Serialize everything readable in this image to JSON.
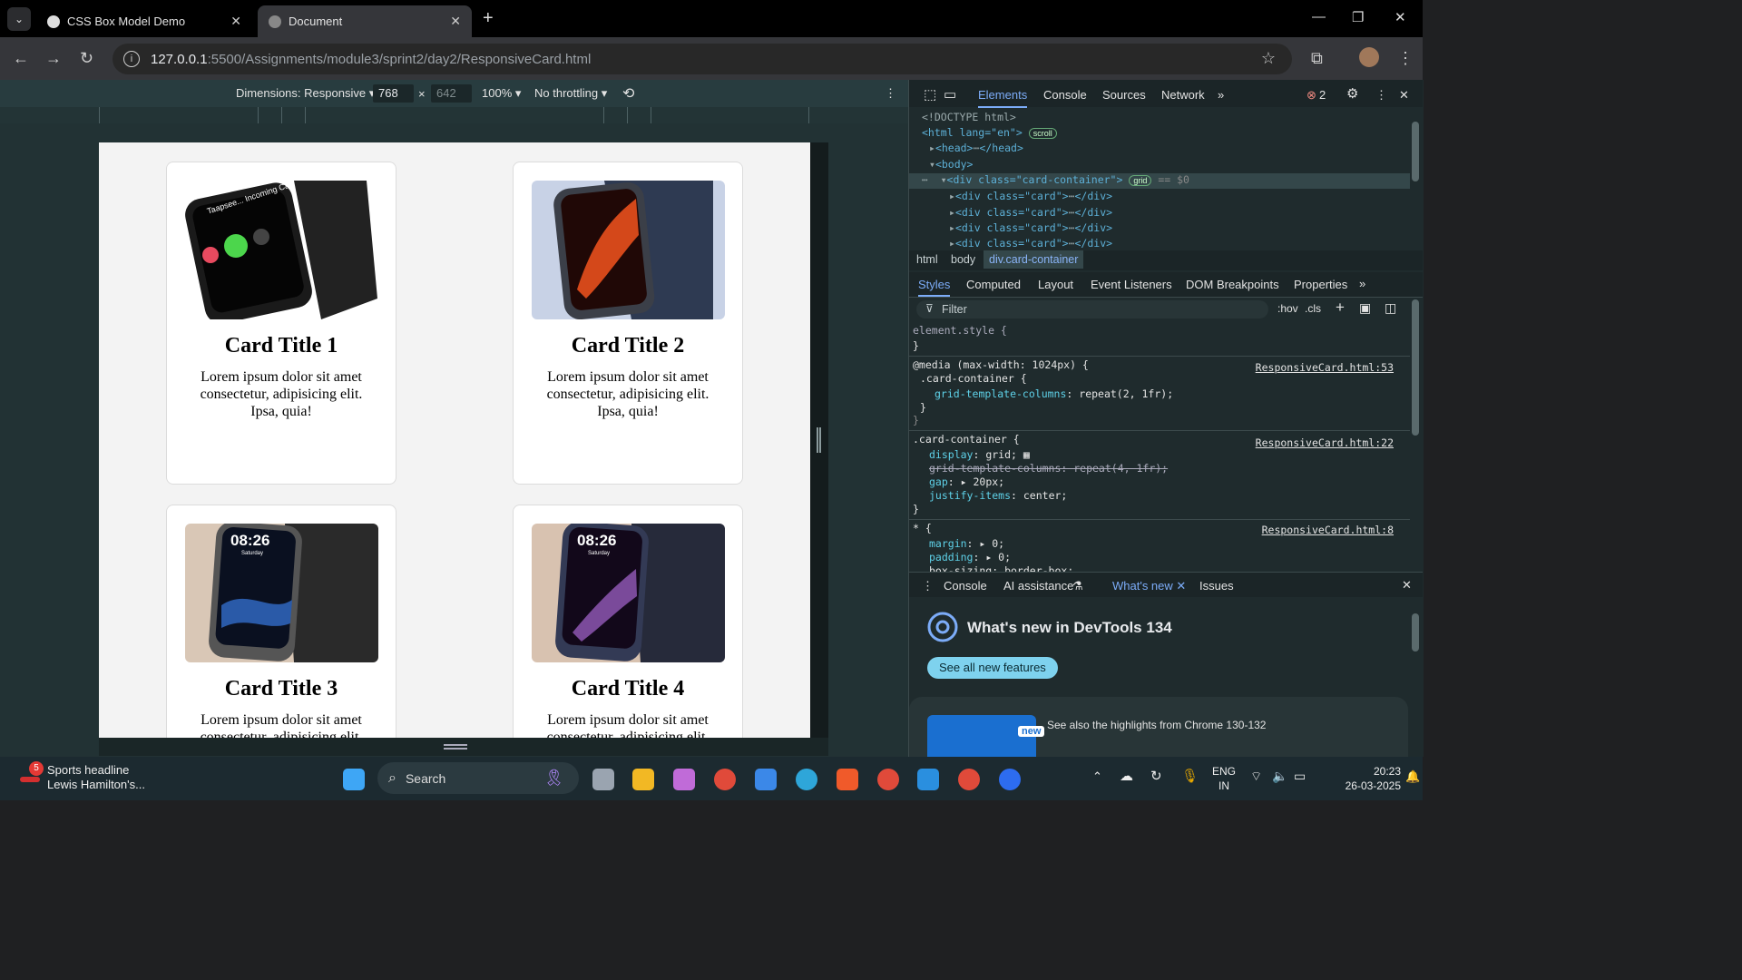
{
  "browser": {
    "tabs": [
      {
        "title": "CSS Box Model Demo",
        "active": false
      },
      {
        "title": "Document",
        "active": true
      }
    ],
    "url_host": "127.0.0.1",
    "url_path": ":5500/Assignments/module3/sprint2/day2/ResponsiveCard.html"
  },
  "device_toolbar": {
    "dimensions": "Dimensions: Responsive",
    "width": "768",
    "height": "642",
    "times": "×",
    "zoom": "100%",
    "throttling": "No throttling"
  },
  "page": {
    "cards": [
      {
        "title": "Card Title 1",
        "text": "Lorem ipsum dolor sit amet consectetur, adipisicing elit. Ipsa, quia!",
        "image": "smartwatch-incoming-call",
        "watch_text": "Taapsee... Incoming Call"
      },
      {
        "title": "Card Title 2",
        "text": "Lorem ipsum dolor sit amet consectetur, adipisicing elit. Ipsa, quia!",
        "image": "smartwatch-side-view"
      },
      {
        "title": "Card Title 3",
        "text": "Lorem ipsum dolor sit amet consectetur, adipisicing elit.",
        "image": "smartwatch-time",
        "watch_time": "08:26",
        "watch_day": "Saturday"
      },
      {
        "title": "Card Title 4",
        "text": "Lorem ipsum dolor sit amet consectetur, adipisicing elit.",
        "image": "smartwatch-time-purple",
        "watch_time": "08:26",
        "watch_day": "Saturday"
      }
    ]
  },
  "devtools": {
    "tabs": [
      "Elements",
      "Console",
      "Sources",
      "Network"
    ],
    "error_count": "2",
    "dom": {
      "doctype": "<!DOCTYPE html>",
      "html_open": "<html lang=\"en\">",
      "scroll_badge": "scroll",
      "head": "<head>",
      "head_close": "</head>",
      "body": "<body>",
      "container_open": "<div class=\"card-container\">",
      "grid_badge": "grid",
      "selected_marker": "== $0",
      "card_div": "<div class=\"card\">",
      "div_close": "</div>"
    },
    "breadcrumbs": [
      "html",
      "body",
      "div.card-container"
    ],
    "style_tabs": [
      "Styles",
      "Computed",
      "Layout",
      "Event Listeners",
      "DOM Breakpoints",
      "Properties"
    ],
    "filter_placeholder": "Filter",
    "hov": ":hov",
    "cls": ".cls",
    "styles": {
      "element_style": "element.style {",
      "close": "}",
      "media": "@media (max-width: 1024px) {",
      "media_src": "ResponsiveCard.html:53",
      "media_selector": ".card-container {",
      "media_prop": "grid-template-columns",
      "media_val": "repeat(2, 1fr);",
      "rule_selector": ".card-container {",
      "rule_src": "ResponsiveCard.html:22",
      "display_prop": "display",
      "display_val": "grid;",
      "gtc_struck": "grid-template-columns: repeat(4, 1fr);",
      "gap_prop": "gap",
      "gap_val": "20px;",
      "justify_prop": "justify-items",
      "justify_val": "center;",
      "star_selector": "* {",
      "star_src": "ResponsiveCard.html:8",
      "margin_prop": "margin",
      "margin_val": "0;",
      "padding_prop": "padding",
      "padding_val": "0;",
      "boxsizing": "box-sizing: border-box;"
    },
    "drawer_tabs": [
      "Console",
      "AI assistance",
      "What's new",
      "Issues"
    ],
    "whats_new_title": "What's new in DevTools 134",
    "see_all": "See all new features",
    "new_badge": "new",
    "highlights": "See also the highlights from Chrome 130-132"
  },
  "taskbar": {
    "news_badge": "5",
    "news_title": "Sports headline",
    "news_sub": "Lewis Hamilton's...",
    "search": "Search",
    "lang1": "ENG",
    "lang2": "IN",
    "time": "20:23",
    "date": "26-03-2025"
  }
}
